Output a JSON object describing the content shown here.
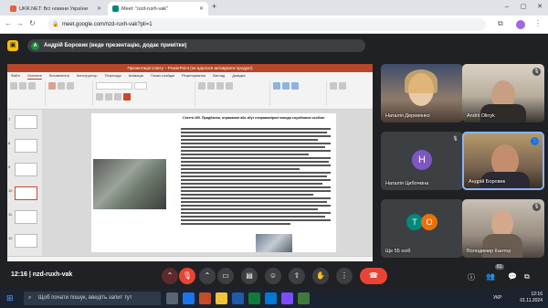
{
  "browser": {
    "tabs": [
      {
        "title": "UKR.NET: Всі новини України",
        "favicon_color": "#e2623d"
      },
      {
        "title": "Meet: \"nzd-ruxh-vak\"",
        "favicon_color": "#00897b"
      }
    ],
    "new_tab": "+",
    "url": "meet.google.com/nzd-ruxh-vak?pli=1",
    "window_controls": [
      "–",
      "▢",
      "✕"
    ]
  },
  "meet": {
    "presenter_banner": "Андрій Боровик (веде презентацію, додає примітки)",
    "presenter_initial": "А",
    "time": "12:16",
    "meeting_code": "nzd-ruxh-vak",
    "participants_count": "61",
    "accent_end_call": "#ea4335"
  },
  "presentation": {
    "window_title": "Презентація іспиту – PowerPoint (не вдалося активувати продукт)",
    "ribbon_tabs": [
      "Файл",
      "Основне",
      "Вставлення",
      "Конструктор",
      "Переходи",
      "Анімація",
      "Показ слайдів",
      "Рецензування",
      "Вигляд",
      "Довідка"
    ],
    "slide_numbers": [
      "7",
      "8",
      "9",
      "10",
      "11",
      "12"
    ],
    "slide_heading": "Стаття 200. Придбання, отримання або збут неправомірної вигоди службовою особою"
  },
  "participants": [
    {
      "name": "Наталія Деревянко",
      "mic_muted": false
    },
    {
      "name": "Andrii Olinyk",
      "mic_muted": true
    },
    {
      "name": "Наталія Цибочкіна",
      "initial": "Н",
      "avatar_color": "#7e57c2",
      "mic_muted": true
    },
    {
      "name": "Андрій Боровик",
      "speaking": true
    },
    {
      "name": "Ще 55 осіб",
      "initials": [
        "Т",
        "О"
      ]
    },
    {
      "name": "Володимир Кантор",
      "mic_muted": true
    }
  ],
  "taskbar": {
    "search_placeholder": "Щоб почати пошук, введіть запит тут",
    "language": "УКР",
    "clock_time": "12:16",
    "clock_date": "01.11.2024"
  }
}
